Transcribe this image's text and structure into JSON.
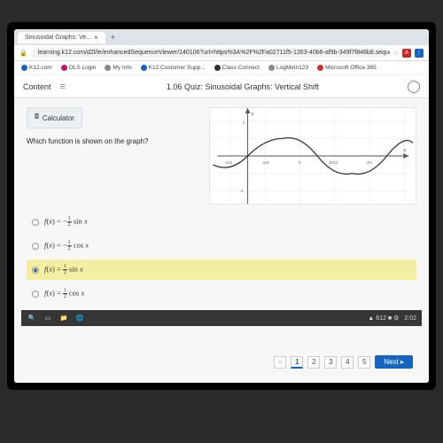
{
  "browser": {
    "tab_title": "Sinusoidal Graphs: Ve...",
    "url": "learning.k12.com/d2l/le/enhancedSequenceViewer/140106?url=https%3A%2F%2Fa02711f5-1353-40b6-af9b-349f7f846b8.sequences.api.brig...",
    "lock": "🔒",
    "bookmarks": [
      {
        "label": "K12.com",
        "color": "#1565c0"
      },
      {
        "label": "OLS Login",
        "color": "#c2185b"
      },
      {
        "label": "My Info",
        "color": "#888"
      },
      {
        "label": "K12 Customer Supp...",
        "color": "#1565c0"
      },
      {
        "label": "Class Connect",
        "color": "#333"
      },
      {
        "label": "LogMeIn123",
        "color": "#888"
      },
      {
        "label": "Microsoft Office 365",
        "color": "#d32f2f"
      }
    ]
  },
  "page": {
    "content_label": "Content",
    "title": "1.06 Quiz: Sinusoidal Graphs: Vertical Shift"
  },
  "quiz": {
    "calculator": "Calculator",
    "question": "Which function is shown on the graph?",
    "options": [
      {
        "text": "f(x) = −½ sin x",
        "selected": false
      },
      {
        "text": "f(x) = −½ cos x",
        "selected": false
      },
      {
        "text": "f(x) = ½ sin x",
        "selected": true
      },
      {
        "text": "f(x) = ½ cos x",
        "selected": false
      }
    ],
    "pager": {
      "prev": "«",
      "pages": [
        "1",
        "2",
        "3",
        "4",
        "5"
      ],
      "active": 1,
      "next": "Next ▸"
    }
  },
  "graph": {
    "y_label": "y",
    "x_label": "x",
    "x_ticks": [
      "−π/2",
      "0",
      "π/2",
      "π",
      "3π/2",
      "2π"
    ],
    "y_range": [
      -1,
      1
    ]
  },
  "chart_data": {
    "type": "line",
    "title": "",
    "xlabel": "x",
    "ylabel": "y",
    "x": [
      -1.571,
      -1.221,
      -0.873,
      -0.524,
      -0.175,
      0.175,
      0.524,
      0.873,
      1.221,
      1.571,
      1.92,
      2.269,
      2.618,
      2.967,
      3.316,
      3.665,
      4.014,
      4.363,
      4.712,
      5.061,
      5.411,
      5.76,
      6.109,
      6.283
    ],
    "y": [
      -0.5,
      -0.47,
      -0.383,
      -0.25,
      -0.087,
      0.087,
      0.25,
      0.383,
      0.47,
      0.5,
      0.47,
      0.383,
      0.25,
      0.087,
      -0.087,
      -0.25,
      -0.383,
      -0.47,
      -0.5,
      -0.47,
      -0.383,
      -0.25,
      -0.087,
      0.0
    ],
    "ylim": [
      -1,
      1
    ]
  },
  "taskbar": {
    "time": "2:02",
    "net": "▲ 612 ■ ⚙"
  }
}
